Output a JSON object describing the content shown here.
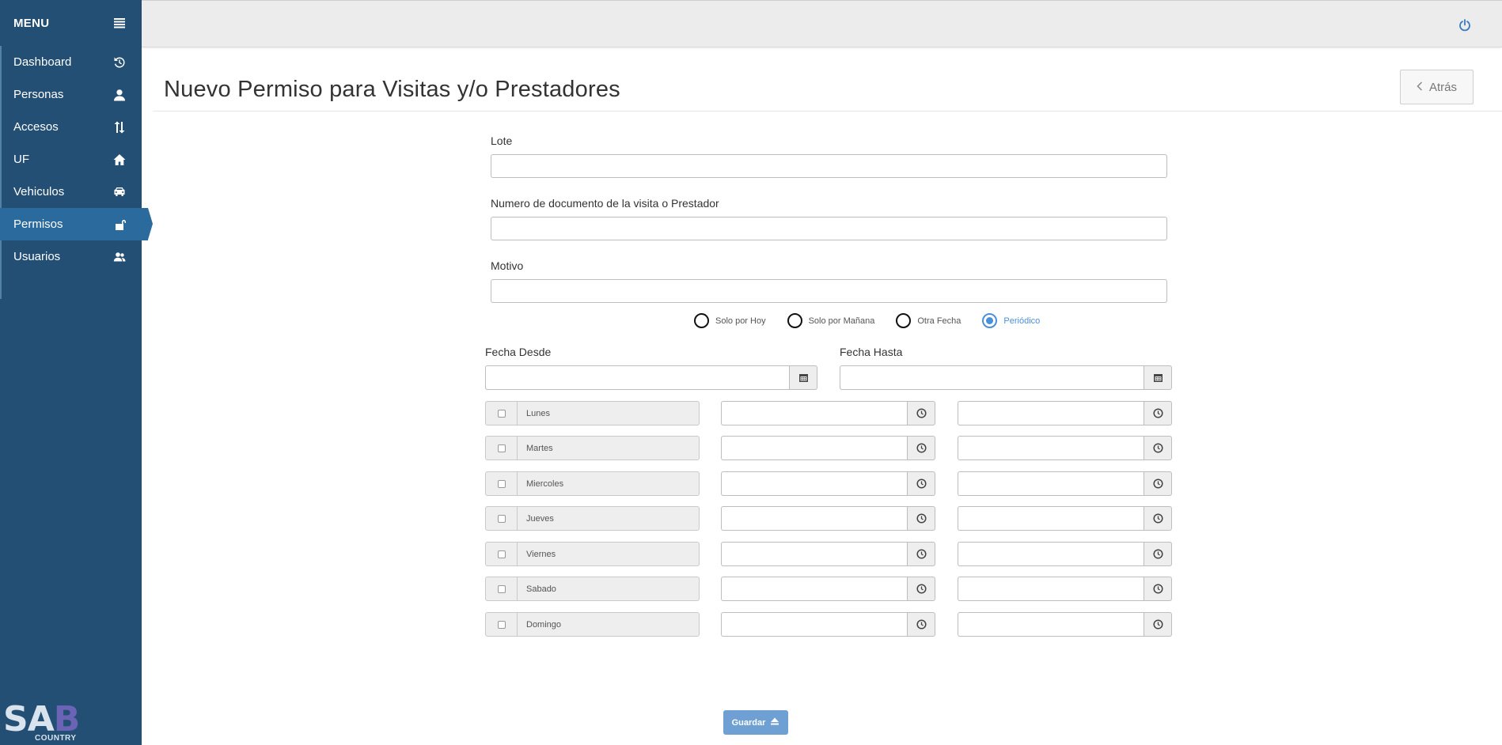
{
  "sidebar": {
    "menu_label": "MENU",
    "items": [
      {
        "label": "Dashboard",
        "icon": "history-icon"
      },
      {
        "label": "Personas",
        "icon": "user-icon"
      },
      {
        "label": "Accesos",
        "icon": "sort-arrows-icon"
      },
      {
        "label": "UF",
        "icon": "home-icon"
      },
      {
        "label": "Vehiculos",
        "icon": "car-icon"
      },
      {
        "label": "Permisos",
        "icon": "unlock-icon",
        "active": true
      },
      {
        "label": "Usuarios",
        "icon": "users-icon"
      }
    ],
    "logo_text": "SAB",
    "logo_subtext": "COUNTRY",
    "background": "#244f74",
    "active_color": "#2a6a9c"
  },
  "topbar": {
    "power_icon": "power-icon"
  },
  "header": {
    "title": "Nuevo Permiso para Visitas y/o Prestadores",
    "back_label": "Atrás"
  },
  "form": {
    "lote_label": "Lote",
    "lote_value": "",
    "documento_label": "Numero de documento de la visita o Prestador",
    "documento_value": "",
    "motivo_label": "Motivo",
    "motivo_value": "",
    "radio_options": [
      "Solo por Hoy",
      "Solo por Mañana",
      "Otra Fecha",
      "Periódico"
    ],
    "radio_selected": "Periódico",
    "fecha_desde_label": "Fecha Desde",
    "fecha_hasta_label": "Fecha Hasta",
    "days": [
      "Lunes",
      "Martes",
      "Miercoles",
      "Jueves",
      "Viernes",
      "Sabado",
      "Domingo"
    ],
    "save_label": "Guardar"
  },
  "colors": {
    "accent": "#4a90d9",
    "save_button": "#6fa0d4"
  }
}
